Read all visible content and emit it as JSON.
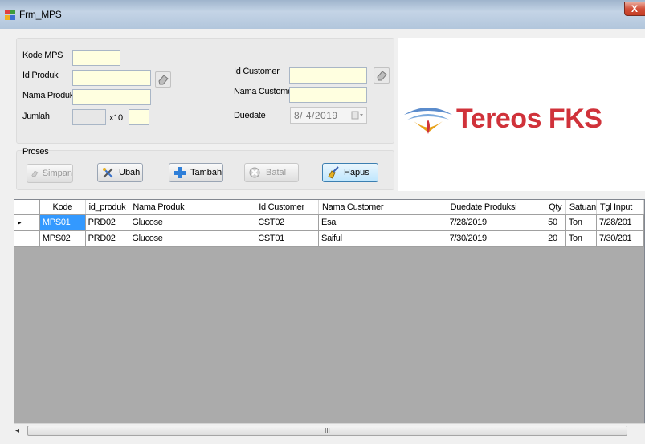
{
  "window": {
    "title": "Frm_MPS",
    "close_label": "X"
  },
  "form": {
    "kode_mps_label": "Kode MPS",
    "id_produk_label": "Id Produk",
    "nama_produk_label": "Nama Produk",
    "jumlah_label": "Jumlah",
    "x10_label": "x10",
    "id_customer_label": "Id Customer",
    "nama_customer_label": "Nama Customer",
    "duedate_label": "Duedate",
    "duedate_value": "8/ 4/2019",
    "kode_mps_value": "",
    "id_produk_value": "",
    "nama_produk_value": "",
    "jumlah_value": "",
    "x10_value": "",
    "id_customer_value": "",
    "nama_customer_value": ""
  },
  "proses": {
    "group_label": "Proses",
    "simpan": "Simpan",
    "ubah": "Ubah",
    "tambah": "Tambah",
    "batal": "Batal",
    "hapus": "Hapus"
  },
  "logo": {
    "text": "Tereos FKS",
    "color": "#d0323a"
  },
  "grid": {
    "columns": [
      "Kode",
      "id_produk",
      "Nama Produk",
      "Id Customer",
      "Nama Customer",
      "Duedate Produksi",
      "Qty",
      "Satuan",
      "Tgl Input"
    ],
    "rows": [
      [
        "MPS01",
        "PRD02",
        "Glucose",
        "CST02",
        "Esa",
        "7/28/2019",
        "50",
        "Ton",
        "7/28/201"
      ],
      [
        "MPS02",
        "PRD02",
        "Glucose",
        "CST01",
        "Saiful",
        "7/30/2019",
        "20",
        "Ton",
        "7/30/201"
      ]
    ],
    "current_row_marker": "▸",
    "scroll_thumb_grip": "III"
  },
  "colors": {
    "input_bg": "#ffffe0",
    "selection": "#3399ff",
    "grid_empty": "#ababab"
  }
}
